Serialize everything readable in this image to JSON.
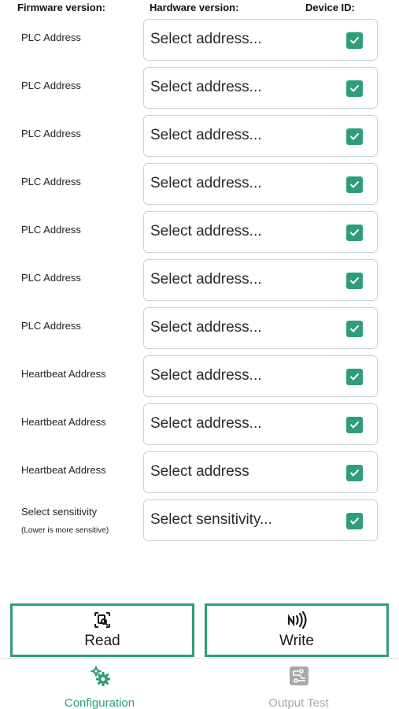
{
  "header": {
    "firmware_label": "Firmware version:",
    "hardware_label": "Hardware version:",
    "device_id_label": "Device ID:"
  },
  "rows": [
    {
      "label": "PLC Address",
      "sublabel": "",
      "value": "Select address...",
      "checked": true
    },
    {
      "label": "PLC Address",
      "sublabel": "",
      "value": "Select address...",
      "checked": true
    },
    {
      "label": "PLC Address",
      "sublabel": "",
      "value": "Select address...",
      "checked": true
    },
    {
      "label": "PLC Address",
      "sublabel": "",
      "value": "Select address...",
      "checked": true
    },
    {
      "label": "PLC Address",
      "sublabel": "",
      "value": "Select address...",
      "checked": true
    },
    {
      "label": "PLC Address",
      "sublabel": "",
      "value": "Select address...",
      "checked": true
    },
    {
      "label": "PLC Address",
      "sublabel": "",
      "value": "Select address...",
      "checked": true
    },
    {
      "label": "Heartbeat Address",
      "sublabel": "",
      "value": "Select address...",
      "checked": true
    },
    {
      "label": "Heartbeat Address",
      "sublabel": "",
      "value": "Select address...",
      "checked": true
    },
    {
      "label": "Heartbeat Address",
      "sublabel": "",
      "value": "Select address",
      "checked": true
    },
    {
      "label": "Select sensitivity",
      "sublabel": "(Lower is more sensitive)",
      "value": "Select sensitivity...",
      "checked": true
    }
  ],
  "actions": {
    "read_label": "Read",
    "read_icon": "scan-search-icon",
    "write_label": "Write",
    "write_icon": "nfc-icon"
  },
  "bottom_nav": {
    "tabs": [
      {
        "label": "Configuration",
        "icon": "gears-icon",
        "active": true
      },
      {
        "label": "Output Test",
        "icon": "circuit-icon",
        "active": false
      }
    ]
  },
  "colors": {
    "accent": "#2e9e76",
    "inactive": "#a9a9a9",
    "border": "#cfcfcf"
  }
}
